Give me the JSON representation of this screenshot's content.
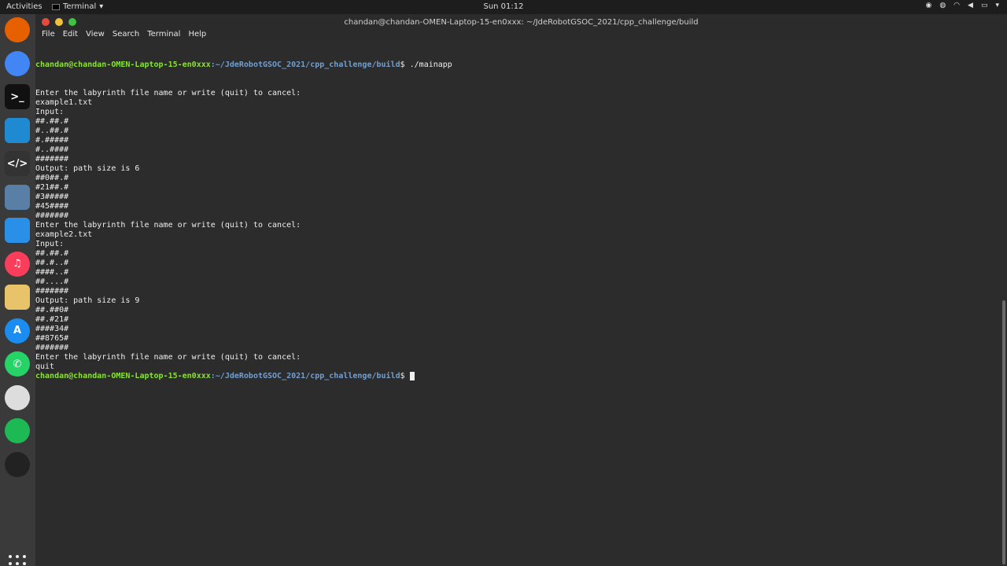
{
  "topbar": {
    "activities": "Activities",
    "app_menu": "Terminal",
    "clock": "Sun 01:12"
  },
  "window": {
    "title": "chandan@chandan-OMEN-Laptop-15-en0xxx: ~/JdeRobotGSOC_2021/cpp_challenge/build"
  },
  "menu": [
    "File",
    "Edit",
    "View",
    "Search",
    "Terminal",
    "Help"
  ],
  "dock": [
    {
      "name": "firefox-icon",
      "glyph": "",
      "color": "#e66000"
    },
    {
      "name": "chrome-icon",
      "glyph": "",
      "color": "#4285f4"
    },
    {
      "name": "terminal-icon",
      "glyph": ">_",
      "color": "#111111"
    },
    {
      "name": "vscode-icon",
      "glyph": "",
      "color": "#1f8ad2"
    },
    {
      "name": "code-editor-icon",
      "glyph": "</>",
      "color": "#333333"
    },
    {
      "name": "image-viewer-icon",
      "glyph": "",
      "color": "#5a7fa6"
    },
    {
      "name": "finder-icon",
      "glyph": "",
      "color": "#2a8fe6"
    },
    {
      "name": "music-icon",
      "glyph": "♫",
      "color": "#fa3d5a"
    },
    {
      "name": "text-editor-icon",
      "glyph": "",
      "color": "#e8c36a"
    },
    {
      "name": "app-store-icon",
      "glyph": "A",
      "color": "#1b8cf0"
    },
    {
      "name": "whatsapp-icon",
      "glyph": "✆",
      "color": "#25d366"
    },
    {
      "name": "settings-ring-icon",
      "glyph": "",
      "color": "#dddddd"
    },
    {
      "name": "spotify-icon",
      "glyph": "",
      "color": "#1db954"
    },
    {
      "name": "obs-icon",
      "glyph": "",
      "color": "#222222"
    }
  ],
  "terminal": {
    "prompt_user": "chandan@chandan-OMEN-Laptop-15-en0xxx",
    "prompt_path": ":~/JdeRobotGSOC_2021/cpp_challenge/build",
    "prompt_symbol": "$",
    "first_command": " ./mainapp",
    "output_lines": [
      "Enter the labyrinth file name or write (quit) to cancel:",
      "example1.txt",
      "Input:",
      "##.##.#",
      "#..##.#",
      "#.#####",
      "#..####",
      "#######",
      "Output: path size is 6",
      "##0##.#",
      "#21##.#",
      "#3#####",
      "#45####",
      "#######",
      "Enter the labyrinth file name or write (quit) to cancel:",
      "example2.txt",
      "Input:",
      "##.##.#",
      "##.#..#",
      "####..#",
      "##....#",
      "#######",
      "Output: path size is 9",
      "##.##0#",
      "##.#21#",
      "####34#",
      "##8765#",
      "#######",
      "Enter the labyrinth file name or write (quit) to cancel:",
      "quit"
    ]
  }
}
